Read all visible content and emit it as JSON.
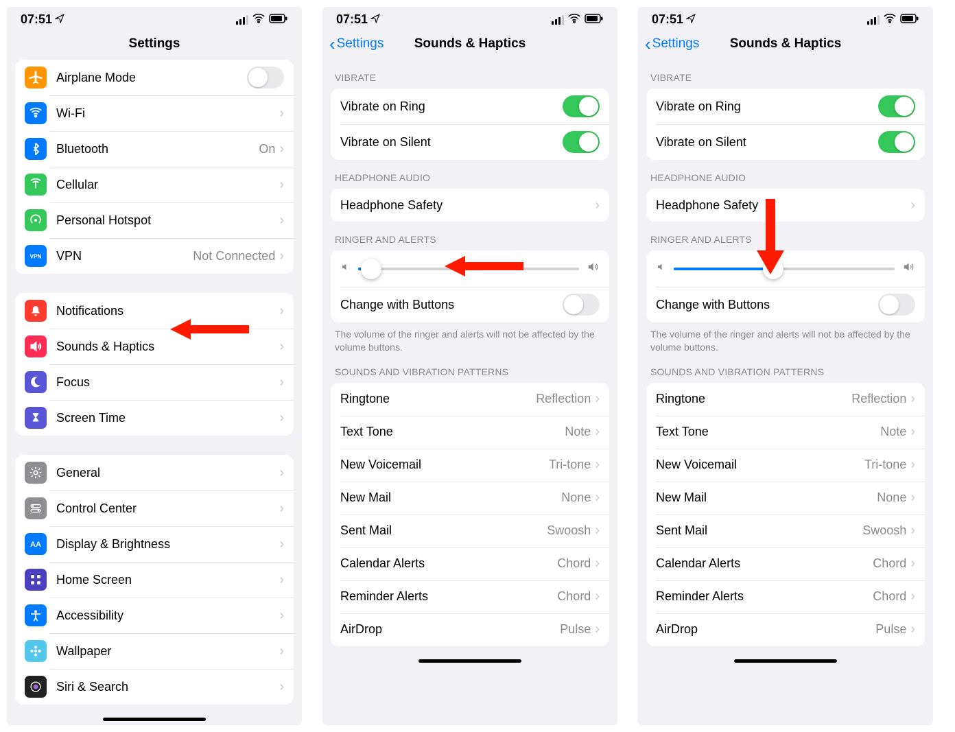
{
  "status": {
    "time": "07:51"
  },
  "screen1": {
    "title": "Settings",
    "groups": [
      {
        "rows": [
          {
            "icon": "airplane",
            "bg": "#ff9500",
            "label": "Airplane Mode",
            "control": "toggle-off"
          },
          {
            "icon": "wifi",
            "bg": "#007aff",
            "label": "Wi-Fi",
            "value": "",
            "control": "chevron"
          },
          {
            "icon": "bluetooth",
            "bg": "#007aff",
            "label": "Bluetooth",
            "value": "On",
            "control": "chevron"
          },
          {
            "icon": "cellular",
            "bg": "#34c759",
            "label": "Cellular",
            "control": "chevron"
          },
          {
            "icon": "hotspot",
            "bg": "#34c759",
            "label": "Personal Hotspot",
            "control": "chevron"
          },
          {
            "icon": "vpn",
            "bg": "#007aff",
            "label": "VPN",
            "value": "Not Connected",
            "control": "chevron"
          }
        ]
      },
      {
        "rows": [
          {
            "icon": "bell",
            "bg": "#ff3b30",
            "label": "Notifications",
            "control": "chevron"
          },
          {
            "icon": "speaker",
            "bg": "#ff2d55",
            "label": "Sounds & Haptics",
            "control": "chevron",
            "highlight": true
          },
          {
            "icon": "moon",
            "bg": "#5856d6",
            "label": "Focus",
            "control": "chevron"
          },
          {
            "icon": "hourglass",
            "bg": "#5856d6",
            "label": "Screen Time",
            "control": "chevron"
          }
        ]
      },
      {
        "rows": [
          {
            "icon": "gear",
            "bg": "#8e8e93",
            "label": "General",
            "control": "chevron"
          },
          {
            "icon": "switches",
            "bg": "#8e8e93",
            "label": "Control Center",
            "control": "chevron"
          },
          {
            "icon": "aa",
            "bg": "#007aff",
            "label": "Display & Brightness",
            "control": "chevron"
          },
          {
            "icon": "grid",
            "bg": "#4b3fbf",
            "label": "Home Screen",
            "control": "chevron"
          },
          {
            "icon": "access",
            "bg": "#007aff",
            "label": "Accessibility",
            "control": "chevron"
          },
          {
            "icon": "flower",
            "bg": "#54c7ec",
            "label": "Wallpaper",
            "control": "chevron"
          },
          {
            "icon": "siri",
            "bg": "#222",
            "label": "Siri & Search",
            "control": "chevron"
          }
        ]
      }
    ]
  },
  "screen23": {
    "back": "Settings",
    "title": "Sounds & Haptics",
    "headers": {
      "vibrate": "Vibrate",
      "headphone": "Headphone Audio",
      "ringer": "Ringer and Alerts",
      "patterns": "Sounds and Vibration Patterns"
    },
    "vibrate": [
      {
        "label": "Vibrate on Ring",
        "on": true
      },
      {
        "label": "Vibrate on Silent",
        "on": true
      }
    ],
    "headphone": {
      "label": "Headphone Safety"
    },
    "change_buttons": {
      "label": "Change with Buttons",
      "on": false
    },
    "ringer_footer": "The volume of the ringer and alerts will not be affected by the volume buttons.",
    "patterns": [
      {
        "label": "Ringtone",
        "value": "Reflection"
      },
      {
        "label": "Text Tone",
        "value": "Note"
      },
      {
        "label": "New Voicemail",
        "value": "Tri-tone"
      },
      {
        "label": "New Mail",
        "value": "None"
      },
      {
        "label": "Sent Mail",
        "value": "Swoosh"
      },
      {
        "label": "Calendar Alerts",
        "value": "Chord"
      },
      {
        "label": "Reminder Alerts",
        "value": "Chord"
      },
      {
        "label": "AirDrop",
        "value": "Pulse"
      }
    ],
    "slider": {
      "low_pct": 6,
      "mid_pct": 45
    }
  }
}
